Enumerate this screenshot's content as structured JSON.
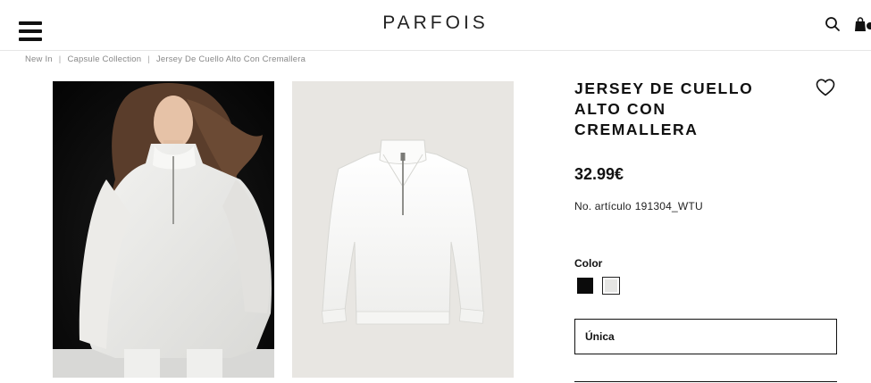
{
  "header": {
    "logo": "PARFOIS",
    "menu_icon": "hamburger-menu-icon",
    "search_icon": "search-icon",
    "bag_icon": "shopping-bag-icon"
  },
  "breadcrumb": {
    "items": [
      "New In",
      "Capsule Collection",
      "Jersey De Cuello Alto Con Cremallera"
    ],
    "separator": "|"
  },
  "gallery": {
    "images": [
      {
        "name": "model-photo"
      },
      {
        "name": "product-photo"
      }
    ]
  },
  "product": {
    "title": "JERSEY DE CUELLO ALTO CON CREMALLERA",
    "price": "32.99€",
    "sku_label": "No. artículo",
    "sku_value": "191304_WTU",
    "wishlist_icon": "heart-icon",
    "color_label": "Color",
    "colors": [
      {
        "name": "black",
        "hex": "#0b0b0b",
        "selected": false
      },
      {
        "name": "white",
        "hex": "#e5e5e3",
        "selected": true
      }
    ],
    "size_value": "Única"
  }
}
